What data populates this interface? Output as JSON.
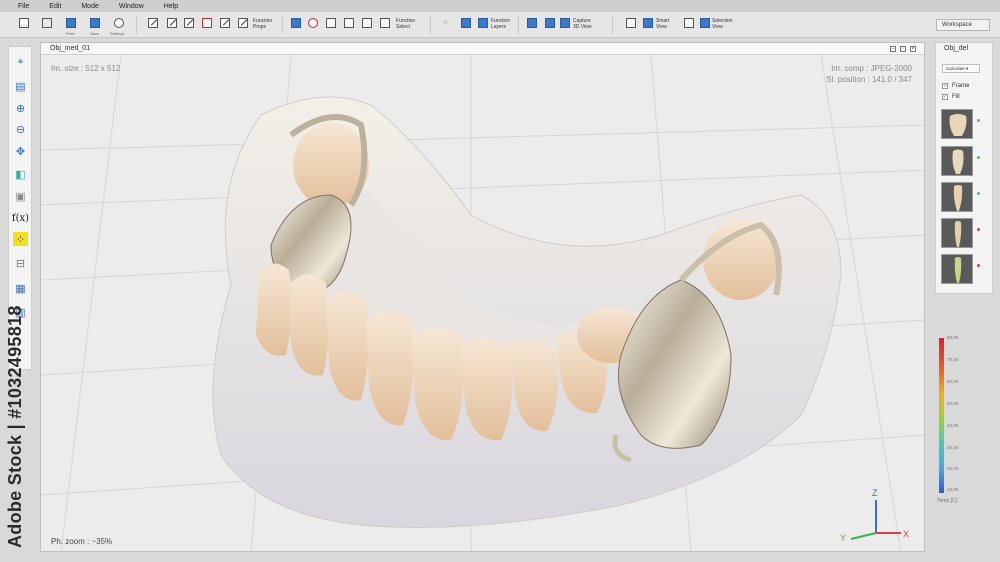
{
  "menu": {
    "items": [
      "File",
      "Edit",
      "Mode",
      "Window",
      "Help"
    ]
  },
  "toolbar": {
    "small_labels": [
      "Print",
      "Save",
      "Settings"
    ],
    "groups": [
      {
        "label": "Function\nProps"
      },
      {
        "label": "Function\nSelect"
      },
      {
        "label": "Function\nLayers"
      },
      {
        "label": "Capture\n3D View"
      },
      {
        "label": "Smart\nView"
      },
      {
        "label": "Selection\nView"
      }
    ],
    "workspace_label": "Workspace"
  },
  "left_tools": [
    {
      "icon": "crosshair-icon",
      "glyph": "⌖"
    },
    {
      "icon": "window-icon",
      "glyph": "▤"
    },
    {
      "icon": "zoom-in-icon",
      "glyph": "⊕"
    },
    {
      "icon": "zoom-out-icon",
      "glyph": "⊖"
    },
    {
      "icon": "move-icon",
      "glyph": "✥"
    },
    {
      "icon": "cube-icon",
      "glyph": "◧"
    },
    {
      "icon": "wireframe-cube-icon",
      "glyph": "▣"
    },
    {
      "icon": "function-icon",
      "glyph": "f(x)"
    },
    {
      "icon": "points-icon",
      "glyph": "⁘"
    },
    {
      "icon": "ruler-icon",
      "glyph": "⊟"
    },
    {
      "icon": "layout-icon",
      "glyph": "▦"
    },
    {
      "icon": "stack-icon",
      "glyph": "▥"
    }
  ],
  "viewport": {
    "title": "Obj_med_01",
    "im_size": "Im. size : 512 x 512",
    "im_comp": "Im. comp : JPEG-2000",
    "sl_position": "Sl. position : 141.0 / 347",
    "zoom": "Ph. zoom : ~35%",
    "axes": {
      "x": "X",
      "y": "Y",
      "z": "Z"
    }
  },
  "right_panel": {
    "title": "Obj_del",
    "dropdown": "Calculate",
    "checkboxes": [
      {
        "label": "Frame",
        "checked": true
      },
      {
        "label": "Fill",
        "checked": true
      }
    ],
    "thumbnails": [
      {
        "name": "molar-thumb",
        "dot": "#5cc26a"
      },
      {
        "name": "premolar-thumb",
        "dot": "#5cc26a"
      },
      {
        "name": "canine-thumb",
        "dot": "#5cc26a"
      },
      {
        "name": "incisor-thumb",
        "dot": "#d24a4a"
      },
      {
        "name": "lateral-thumb",
        "dot": "#d24a4a"
      }
    ]
  },
  "color_scale": {
    "labels": [
      "80,00",
      "70,00",
      "60,00",
      "50,00",
      "40,00",
      "30,00",
      "20,00",
      "10,00"
    ],
    "unit": "Temp [C]",
    "colors": {
      "top": "#d8203a",
      "bottom": "#3a58c8"
    }
  },
  "watermark": {
    "stock_id": "Adobe Stock | #1032495818",
    "text": "Adobe Stock"
  }
}
